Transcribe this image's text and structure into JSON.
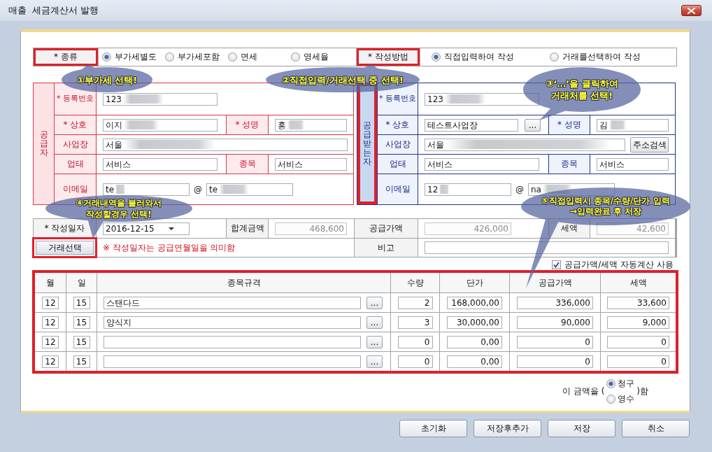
{
  "window": {
    "title": "매출  세금계산서 발행"
  },
  "type_row": {
    "label": "* 종류",
    "highlighted": true,
    "options": [
      {
        "label": "부가세별도",
        "selected": true
      },
      {
        "label": "부가세포함",
        "selected": false
      },
      {
        "label": "면세",
        "selected": false
      },
      {
        "label": "영세율",
        "selected": false
      }
    ]
  },
  "method_row": {
    "label": "* 작성방법",
    "highlighted": true,
    "options": [
      {
        "label": "직접입력하여 작성",
        "selected": true
      },
      {
        "label": "거래를선택하여 작성",
        "selected": false
      }
    ]
  },
  "supplier": {
    "title": "공급자",
    "reg_no": {
      "label": "* 등록번호",
      "value": "123",
      "redacted": true
    },
    "company": {
      "label": "* 상호",
      "value": "이지",
      "redacted": true
    },
    "name": {
      "label": "* 성명",
      "value": "홍",
      "redacted": true
    },
    "address": {
      "label": "사업장",
      "value": "서울",
      "redacted": true
    },
    "biz_type": {
      "label": "업태",
      "value": "서비스"
    },
    "biz_item": {
      "label": "종목",
      "value": "서비스"
    },
    "email": {
      "label": "이메일",
      "user": "te",
      "at": "@",
      "domain": "te",
      "redacted": true
    }
  },
  "receiver": {
    "title": "공급받는자",
    "highlighted": true,
    "reg_no": {
      "label": "* 등록번호",
      "value": "123",
      "redacted": true
    },
    "company": {
      "label": "* 상호",
      "value": "테스트사업장",
      "button": "..."
    },
    "name": {
      "label": "* 성명",
      "value": "김",
      "redacted": true
    },
    "address": {
      "label": "사업장",
      "value": "서울",
      "redacted": true,
      "button": "주소검색"
    },
    "biz_type": {
      "label": "업태",
      "value": "서비스"
    },
    "biz_item": {
      "label": "종목",
      "value": "서비스"
    },
    "email": {
      "label": "이메일",
      "user": "12",
      "at": "@",
      "domain": "na",
      "redacted": true
    }
  },
  "summary": {
    "date": {
      "label": "* 작성일자",
      "value": "2016-12-15"
    },
    "total": {
      "label": "합계금액",
      "value": "468,600",
      "disabled": true
    },
    "supply": {
      "label": "공급가액",
      "value": "426,000",
      "disabled": true
    },
    "tax": {
      "label": "세액",
      "value": "42,600",
      "disabled": true
    },
    "pick_button": {
      "label": "거래선택",
      "highlighted": true
    },
    "note": "※ 작성일자는 공급연월일을 의미함",
    "memo": {
      "label": "비고"
    }
  },
  "auto_calc": {
    "label": "공급가액/세액 자동계산 사용",
    "checked": true
  },
  "items": {
    "highlighted": true,
    "columns": [
      "월",
      "일",
      "종목규격",
      "수량",
      "단가",
      "공급가액",
      "세액"
    ],
    "rows": [
      {
        "month": "12",
        "day": "15",
        "item": "스탠다드",
        "lookup": "...",
        "qty": "2",
        "price": "168,000,00",
        "supply": "336,000",
        "tax": "33,600"
      },
      {
        "month": "12",
        "day": "15",
        "item": "양식지",
        "lookup": "...",
        "qty": "3",
        "price": "30,000,00",
        "supply": "90,000",
        "tax": "9,000"
      },
      {
        "month": "12",
        "day": "15",
        "lookup": "...",
        "qty": "0",
        "price": "0,00",
        "supply": "0",
        "tax": "0"
      },
      {
        "month": "12",
        "day": "15",
        "lookup": "...",
        "qty": "0",
        "price": "0,00",
        "supply": "0",
        "tax": "0"
      }
    ]
  },
  "receipt": {
    "prefix": "이 금액을 (",
    "options": [
      {
        "label": "청구",
        "selected": true
      },
      {
        "label": "영수",
        "selected": false
      }
    ],
    "suffix": ")함"
  },
  "buttons": [
    "초기화",
    "저장후추가",
    "저장",
    "취소"
  ],
  "callouts": [
    {
      "text": "①부가세 선택!"
    },
    {
      "text": "②직접입력/거래선택 중 선택!"
    },
    {
      "text": "③‘…’을 클릭하여\n거래처를 선택!"
    },
    {
      "text": "④거래내역을 불러와서\n작성할경우 선택!"
    },
    {
      "text": "⑤직접입력시 종목/수량/단가 입력\n→입력완료 후 저장"
    }
  ]
}
